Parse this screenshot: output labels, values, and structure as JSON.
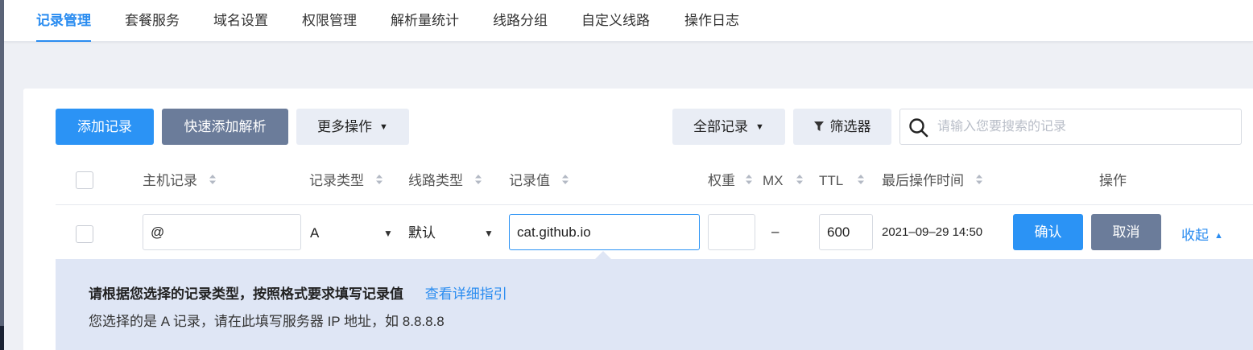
{
  "nav": {
    "tabs": [
      {
        "label": "记录管理",
        "active": true
      },
      {
        "label": "套餐服务"
      },
      {
        "label": "域名设置"
      },
      {
        "label": "权限管理"
      },
      {
        "label": "解析量统计"
      },
      {
        "label": "线路分组"
      },
      {
        "label": "自定义线路"
      },
      {
        "label": "操作日志"
      }
    ]
  },
  "toolbar": {
    "add_record": "添加记录",
    "quick_add": "快速添加解析",
    "more_actions": "更多操作",
    "all_records": "全部记录",
    "filter": "筛选器",
    "search_placeholder": "请输入您要搜索的记录"
  },
  "table": {
    "headers": {
      "host": "主机记录",
      "type": "记录类型",
      "line": "线路类型",
      "value": "记录值",
      "weight": "权重",
      "mx": "MX",
      "ttl": "TTL",
      "last_modified": "最后操作时间",
      "actions": "操作"
    },
    "edit_row": {
      "host": "@",
      "type": "A",
      "line": "默认",
      "value": "cat.github.io",
      "weight": "",
      "mx": "–",
      "ttl": "600",
      "last_modified": "2021–09–29 14:50",
      "confirm": "确认",
      "cancel": "取消",
      "collapse": "收起"
    }
  },
  "hint": {
    "title": "请根据您选择的记录类型，按照格式要求填写记录值",
    "guide_link": "查看详细指引",
    "message": "您选择的是 A 记录，请在此填写服务器 IP 地址，如 8.8.8.8"
  },
  "colors": {
    "accent": "#2b93f5",
    "gray_button": "#6b7c9a",
    "hint_bg": "#dfe6f5"
  }
}
